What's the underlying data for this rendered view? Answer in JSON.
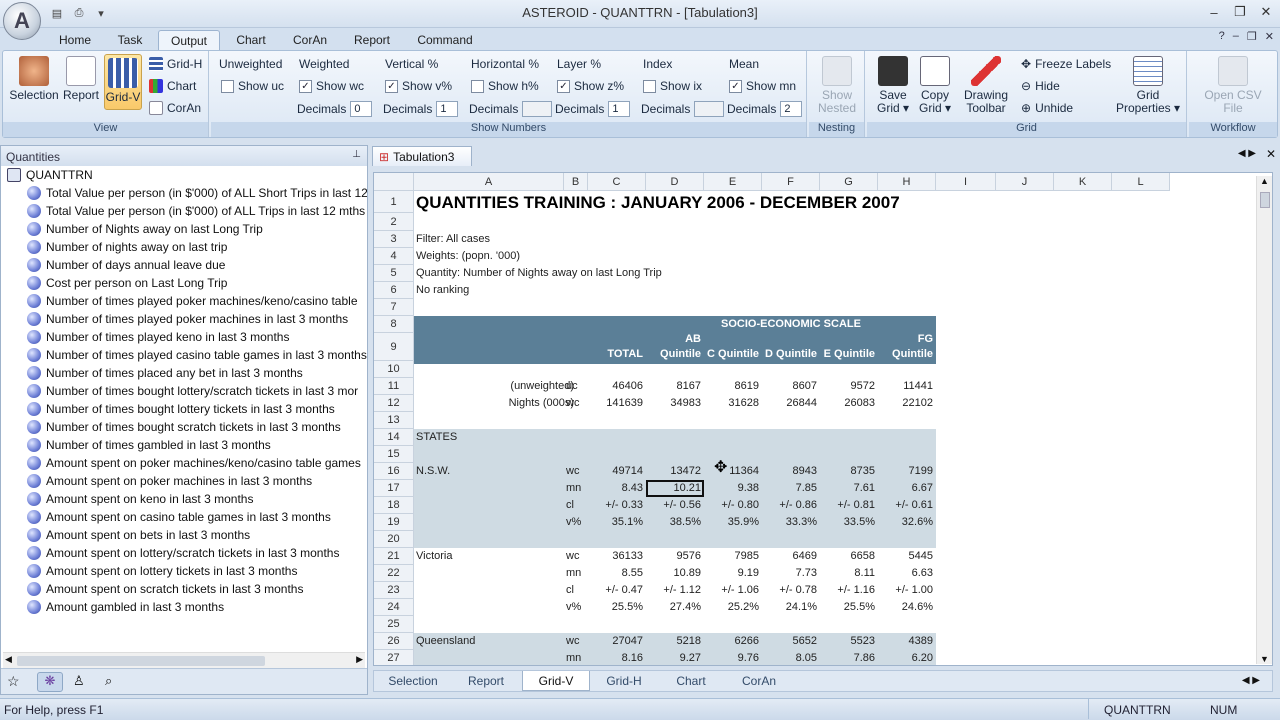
{
  "window": {
    "title": "ASTEROID - QUANTTRN - [Tabulation3]",
    "orb_letter": "A",
    "min": "–",
    "restore": "❐",
    "close": "✕"
  },
  "ribbon_tabs": [
    "Home",
    "Task",
    "Output",
    "Chart",
    "CorAn",
    "Report",
    "Command"
  ],
  "ribbon": {
    "view": {
      "label": "View",
      "selection": "Selection",
      "report": "Report",
      "gridv": "Grid-V",
      "gridh": "Grid-H",
      "chart": "Chart",
      "coran": "CorAn"
    },
    "show_numbers": {
      "label": "Show Numbers",
      "unweighted": {
        "title": "Unweighted",
        "check": "Show uc"
      },
      "weighted": {
        "title": "Weighted",
        "check": "Show wc",
        "dec_label": "Decimals",
        "dec": "0"
      },
      "vertical": {
        "title": "Vertical %",
        "check": "Show v%",
        "dec_label": "Decimals",
        "dec": "1"
      },
      "horizontal": {
        "title": "Horizontal %",
        "check": "Show h%",
        "dec_label": "Decimals"
      },
      "layer": {
        "title": "Layer %",
        "check": "Show z%",
        "dec_label": "Decimals",
        "dec": "1"
      },
      "index": {
        "title": "Index",
        "check": "Show ix",
        "dec_label": "Decimals"
      },
      "mean": {
        "title": "Mean",
        "check": "Show mn",
        "dec_label": "Decimals",
        "dec": "2"
      }
    },
    "nesting": {
      "label": "Nesting",
      "btn1": "Show",
      "btn2": "Nested"
    },
    "grid": {
      "label": "Grid",
      "save1": "Save",
      "save2": "Grid ▾",
      "copy1": "Copy",
      "copy2": "Grid ▾",
      "draw1": "Drawing",
      "draw2": "Toolbar",
      "freeze": "Freeze Labels",
      "hide": "Hide",
      "unhide": "Unhide",
      "props1": "Grid",
      "props2": "Properties ▾"
    },
    "workflow": {
      "label": "Workflow",
      "csv1": "Open CSV",
      "csv2": "File"
    }
  },
  "quantities": {
    "title": "Quantities",
    "root": "QUANTTRN",
    "items": [
      "Total Value per person (in $'000) of ALL Short Trips in last 12",
      "Total Value per person (in $'000) of ALL Trips in last 12 mths",
      "Number of Nights away on last Long Trip",
      "Number of nights away on last trip",
      "Number of days annual leave due",
      "Cost per person on Last Long Trip",
      "Number of times played poker machines/keno/casino table",
      "Number of times played poker machines in last 3 months",
      "Number of times played keno in last 3 months",
      "Number of times played casino table games in last 3 months",
      "Number of times placed any bet in last 3 months",
      "Number of times bought lottery/scratch tickets in last 3 mor",
      "Number of times bought lottery tickets in last 3 months",
      "Number of times bought scratch tickets in last 3 months",
      "Number of times gambled in last 3 months",
      "Amount spent on poker machines/keno/casino table games",
      "Amount spent on poker machines in last 3 months",
      "Amount spent on keno in last 3 months",
      "Amount spent on casino table games in last 3 months",
      "Amount spent on bets in last 3 months",
      "Amount spent on lottery/scratch tickets in last 3 months",
      "Amount spent on lottery tickets in last 3 months",
      "Amount spent on scratch tickets in last 3 months",
      "Amount gambled in last 3 months"
    ]
  },
  "doc_tab": "Tabulation3",
  "grid": {
    "cols": [
      "A",
      "B",
      "C",
      "D",
      "E",
      "F",
      "G",
      "H",
      "I",
      "J",
      "K",
      "L"
    ],
    "rows": [
      "1",
      "2",
      "3",
      "4",
      "5",
      "6",
      "7",
      "8",
      "9",
      "10",
      "11",
      "12",
      "13",
      "14",
      "15",
      "16",
      "17",
      "18",
      "19",
      "20",
      "21",
      "22",
      "23",
      "24",
      "25",
      "26",
      "27"
    ],
    "title": "QUANTITIES TRAINING : JANUARY 2006 - DECEMBER 2007",
    "meta": [
      "Filter: All cases",
      "Weights: (popn. '000)",
      "Quantity: Number of Nights away on last Long Trip",
      "No ranking"
    ],
    "banner": "SOCIO-ECONOMIC SCALE",
    "colhdr_top": [
      "",
      "AB",
      "",
      "",
      "",
      "FG"
    ],
    "colhdr_bottom": [
      "TOTAL",
      "Quintile",
      "C Quintile",
      "D Quintile",
      "E Quintile",
      "Quintile"
    ],
    "base_rows": [
      {
        "label": "(unweighted)",
        "code": "uc",
        "vals": [
          "46406",
          "8167",
          "8619",
          "8607",
          "9572",
          "11441"
        ]
      },
      {
        "label": "Nights (000s)",
        "code": "wc",
        "vals": [
          "141639",
          "34983",
          "31628",
          "26844",
          "26083",
          "22102"
        ]
      }
    ],
    "section": "STATES",
    "states": [
      {
        "name": "N.S.W.",
        "rows": [
          [
            "wc",
            "49714",
            "13472",
            "11364",
            "8943",
            "8735",
            "7199"
          ],
          [
            "mn",
            "8.43",
            "10.21",
            "9.38",
            "7.85",
            "7.61",
            "6.67"
          ],
          [
            "cl",
            "+/- 0.33",
            "+/- 0.56",
            "+/- 0.80",
            "+/- 0.86",
            "+/- 0.81",
            "+/- 0.61"
          ],
          [
            "v%",
            "35.1%",
            "38.5%",
            "35.9%",
            "33.3%",
            "33.5%",
            "32.6%"
          ]
        ]
      },
      {
        "name": "Victoria",
        "rows": [
          [
            "wc",
            "36133",
            "9576",
            "7985",
            "6469",
            "6658",
            "5445"
          ],
          [
            "mn",
            "8.55",
            "10.89",
            "9.19",
            "7.73",
            "8.11",
            "6.63"
          ],
          [
            "cl",
            "+/- 0.47",
            "+/- 1.12",
            "+/- 1.06",
            "+/- 0.78",
            "+/- 1.16",
            "+/- 1.00"
          ],
          [
            "v%",
            "25.5%",
            "27.4%",
            "25.2%",
            "24.1%",
            "25.5%",
            "24.6%"
          ]
        ]
      },
      {
        "name": "Queensland",
        "rows": [
          [
            "wc",
            "27047",
            "5218",
            "6266",
            "5652",
            "5523",
            "4389"
          ],
          [
            "mn",
            "8.16",
            "9.27",
            "9.76",
            "8.05",
            "7.86",
            "6.20"
          ]
        ]
      }
    ]
  },
  "sheet_tabs": [
    "Selection",
    "Report",
    "Grid-V",
    "Grid-H",
    "Chart",
    "CorAn"
  ],
  "status": {
    "help": "For Help, press F1",
    "project": "QUANTTRN",
    "num": "NUM"
  },
  "colors": {
    "header_bg": "#5b7f97",
    "shade_bg": "#cfdbe3",
    "accent": "#f9c96a"
  }
}
